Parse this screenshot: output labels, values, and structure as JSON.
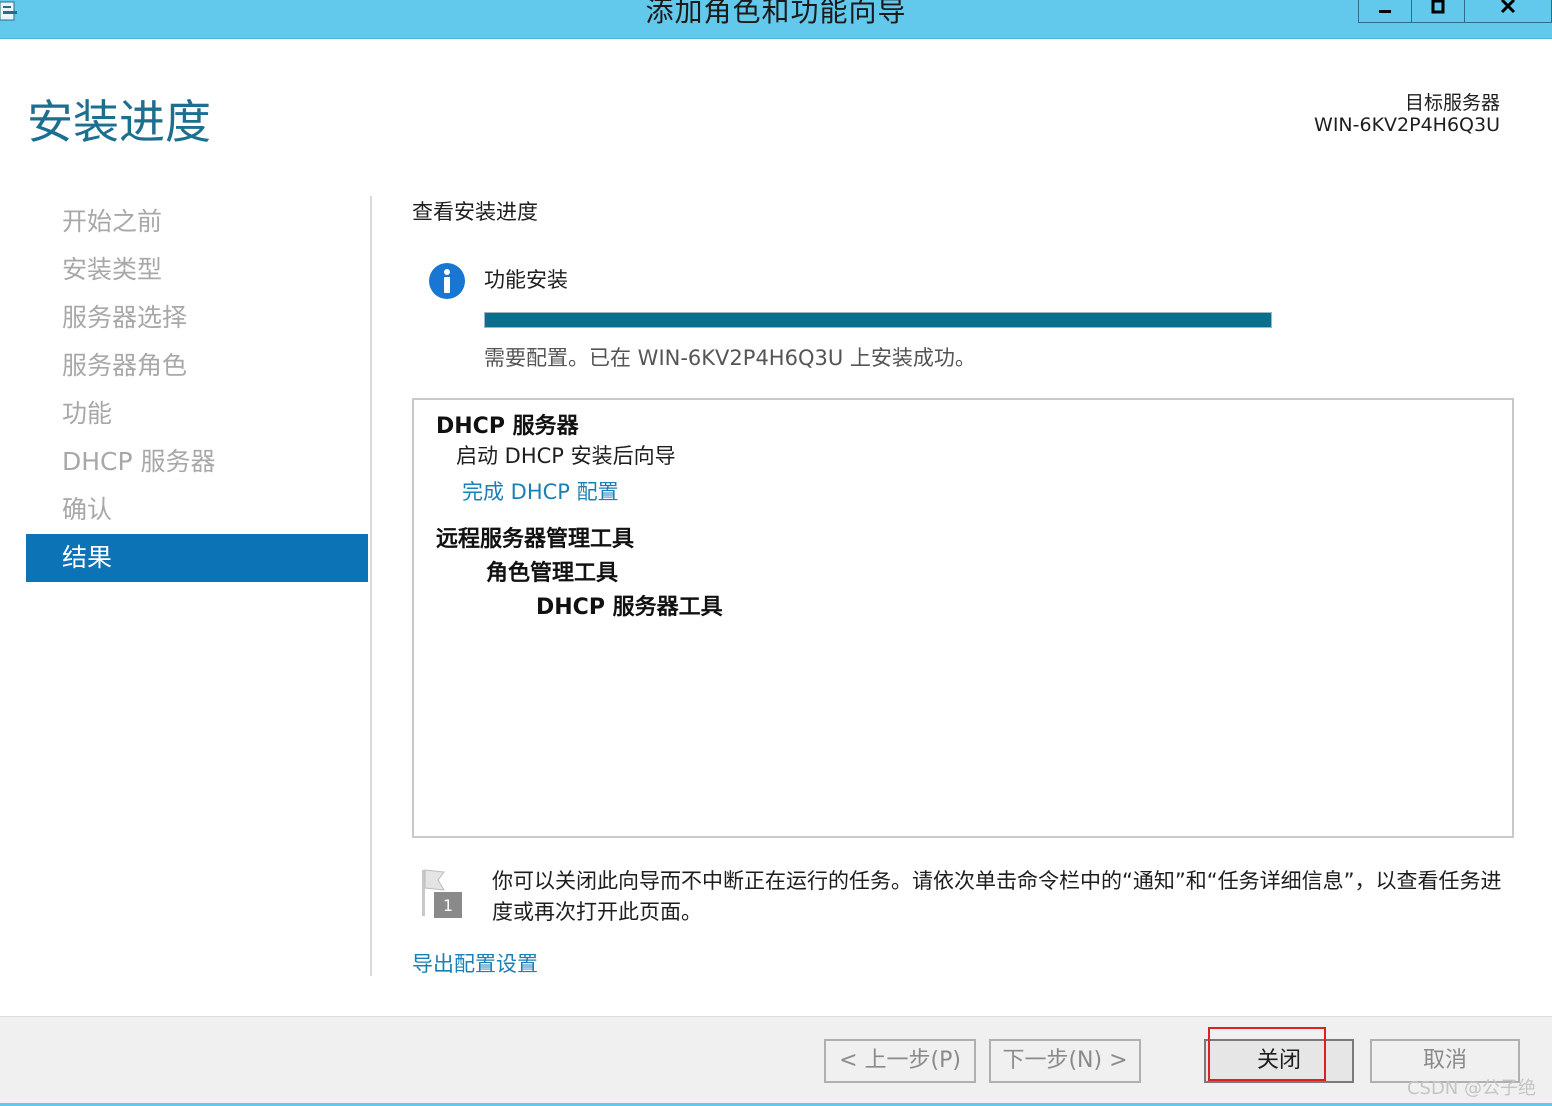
{
  "window": {
    "title": "添加角色和功能向导",
    "controls": [
      "minimize",
      "maximize",
      "close"
    ]
  },
  "header": {
    "page_title": "安装进度",
    "target_label": "目标服务器",
    "target_server": "WIN-6KV2P4H6Q3U"
  },
  "nav": {
    "items": [
      {
        "label": "开始之前",
        "active": false
      },
      {
        "label": "安装类型",
        "active": false
      },
      {
        "label": "服务器选择",
        "active": false
      },
      {
        "label": "服务器角色",
        "active": false
      },
      {
        "label": "功能",
        "active": false
      },
      {
        "label": "DHCP 服务器",
        "active": false
      },
      {
        "label": "确认",
        "active": false
      },
      {
        "label": "结果",
        "active": true
      }
    ]
  },
  "main": {
    "section_heading": "查看安装进度",
    "feature_label": "功能安装",
    "progress": 1.0,
    "status": "需要配置。已在 WIN-6KV2P4H6Q3U 上安装成功。",
    "results": {
      "dhcp_server": "DHCP 服务器",
      "launch_wizard": "启动 DHCP 安装后向导",
      "complete_dhcp_link": "完成 DHCP 配置",
      "rsat": "远程服务器管理工具",
      "role_tools": "角色管理工具",
      "dhcp_tools": "DHCP 服务器工具"
    },
    "notice": "你可以关闭此向导而不中断正在运行的任务。请依次单击命令栏中的“通知”和“任务详细信息”，以查看任务进度或再次打开此页面。",
    "notice_badge": "1",
    "export_link": "导出配置设置"
  },
  "footer": {
    "prev_button": "< 上一步(P)",
    "next_button": "下一步(N) >",
    "close_button": "关闭",
    "cancel_button": "取消"
  },
  "watermark": "CSDN @公子绝",
  "colors": {
    "titlebar": "#63c9ec",
    "accent": "#0b73b6",
    "title_text": "#1c6f8f",
    "link": "#1c80b8",
    "progress": "#0a6f8c",
    "highlight": "#e02020"
  }
}
